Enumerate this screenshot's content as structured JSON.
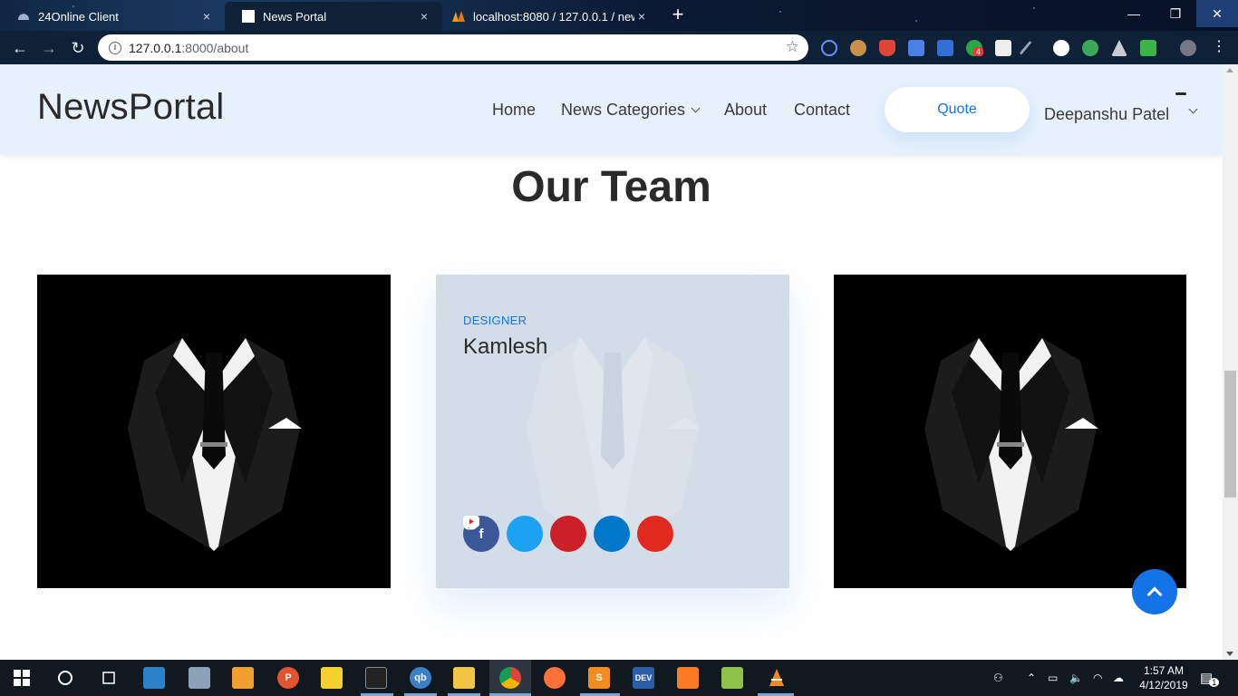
{
  "browser": {
    "tabs": [
      {
        "title": "24Online Client",
        "close": "×"
      },
      {
        "title": "News Portal",
        "close": "×"
      },
      {
        "title": "localhost:8080 / 127.0.0.1 / news",
        "close": "×"
      }
    ],
    "new_tab": "+",
    "window": {
      "minimize": "—",
      "restore": "❐",
      "close": "✕"
    },
    "nav": {
      "back": "←",
      "forward": "→",
      "reload": "↻"
    },
    "url_host": "127.0.0.1",
    "url_path": ":8000/about",
    "info": "i",
    "bookmark": "☆",
    "extension_badge": "4"
  },
  "site": {
    "brand": "NewsPortal",
    "nav": [
      "Home",
      "News Categories",
      "About",
      "Contact"
    ],
    "quote_label": "Quote",
    "user_name": "Deepanshu Patel"
  },
  "section_title": "Our Team",
  "team": [
    {
      "role": "",
      "name": "",
      "image": "suit-image"
    },
    {
      "role": "DESIGNER",
      "name": "Kamlesh",
      "image": "suit-image",
      "socials": [
        {
          "icon": "facebook-icon",
          "glyph": "f",
          "color": "#3b5998"
        },
        {
          "icon": "twitter-icon",
          "glyph": "🐦",
          "color": "#1da1f2"
        },
        {
          "icon": "pinterest-icon",
          "glyph": "℗",
          "color": "#cb2027"
        },
        {
          "icon": "instagram-icon",
          "glyph": "◎",
          "color": "#0077c8"
        },
        {
          "icon": "youtube-icon",
          "glyph": "▶",
          "color": "#e02a20"
        }
      ]
    },
    {
      "role": "",
      "name": "",
      "image": "suit-image"
    }
  ],
  "colors": {
    "accent": "#1473e6",
    "header_bg": "#e6f1fc",
    "card_hover_bg": "#d3dde8"
  },
  "taskbar": {
    "apps": [
      "windows-start-icon",
      "cortana-icon",
      "task-view-icon",
      "control-panel-icon",
      "system-icon",
      "store-icon",
      "postman-icon",
      "sticky-notes-icon",
      "terminal-icon",
      "qbittorrent-icon",
      "file-explorer-icon",
      "chrome-icon",
      "firefox-icon",
      "sublime-icon",
      "devc-icon",
      "xampp-icon",
      "notepadpp-icon",
      "vlc-icon"
    ],
    "qb_label": "qb",
    "dev_label": "DEV",
    "time": "1:57 AM",
    "date": "4/12/2019",
    "notification_count": "1"
  }
}
